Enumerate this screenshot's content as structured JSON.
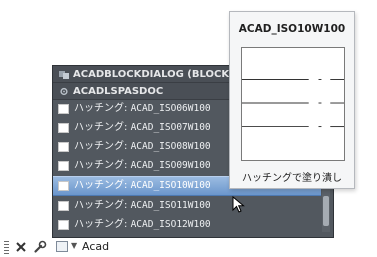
{
  "autocomplete": {
    "headers": [
      {
        "label": "ACADBLOCKDIALOG (BLOCK)",
        "icon": "block-dialog-icon"
      },
      {
        "label": "ACADLSPASDOC",
        "icon": "gear-icon"
      }
    ],
    "items": [
      {
        "prefix": "ハッチング: ",
        "name": "ACAD_ISO06W100"
      },
      {
        "prefix": "ハッチング: ",
        "name": "ACAD_ISO07W100"
      },
      {
        "prefix": "ハッチング: ",
        "name": "ACAD_ISO08W100"
      },
      {
        "prefix": "ハッチング: ",
        "name": "ACAD_ISO09W100"
      },
      {
        "prefix": "ハッチング: ",
        "name": "ACAD_ISO10W100",
        "selected": true
      },
      {
        "prefix": "ハッチング: ",
        "name": "ACAD_ISO11W100"
      },
      {
        "prefix": "ハッチング: ",
        "name": "ACAD_ISO12W100"
      }
    ]
  },
  "preview": {
    "title": "ACAD_ISO10W100",
    "caption": "ハッチングで塗り潰し"
  },
  "command_line": {
    "input": "Acad",
    "tools": [
      "close-icon",
      "wrench-icon"
    ]
  },
  "colors": {
    "list_bg": "#52585f",
    "selected_bg": "#7ea6d7",
    "preview_bg": "#f5f6f7"
  }
}
